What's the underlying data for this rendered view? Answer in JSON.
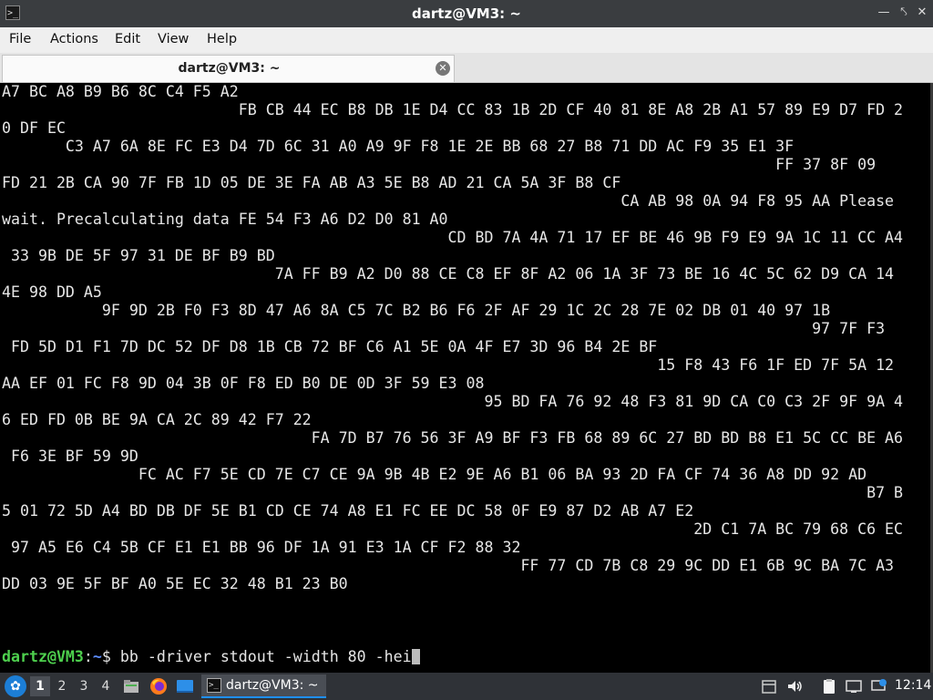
{
  "window": {
    "title": "dartz@VM3: ~"
  },
  "menu": [
    "File",
    "Actions",
    "Edit",
    "View",
    "Help"
  ],
  "tab": {
    "label": "dartz@VM3: ~"
  },
  "terminal": {
    "lines": [
      "A7 BC A8 B9 B6 8C C4 F5 A2",
      "                          FB CB 44 EC B8 DB 1E D4 CC 83 1B 2D CF 40 81 8E A8 2B A1 57 89 E9 D7 FD 2",
      "0 DF EC",
      "       C3 A7 6A 8E FC E3 D4 7D 6C 31 A0 A9 9F F8 1E 2E BB 68 27 B8 71 DD AC F9 35 E1 3F",
      "                                                                                     FF 37 8F 09",
      "FD 21 2B CA 90 7F FB 1D 05 DE 3E FA AB A3 5E B8 AD 21 CA 5A 3F B8 CF",
      "                                                                    CA AB 98 0A 94 F8 95 AA Please",
      "wait. Precalculating data FE 54 F3 A6 D2 D0 81 A0",
      "                                                 CD BD 7A 4A 71 17 EF BE 46 9B F9 E9 9A 1C 11 CC A4",
      " 33 9B DE 5F 97 31 DE BF B9 BD",
      "                              7A FF B9 A2 D0 88 CE C8 EF 8F A2 06 1A 3F 73 BE 16 4C 5C 62 D9 CA 14",
      "4E 98 DD A5",
      "           9F 9D 2B F0 F3 8D 47 A6 8A C5 7C B2 B6 F6 2F AF 29 1C 2C 28 7E 02 DB 01 40 97 1B",
      "                                                                                         97 7F F3",
      " FD 5D D1 F1 7D DC 52 DF D8 1B CB 72 BF C6 A1 5E 0A 4F E7 3D 96 B4 2E BF",
      "                                                                        15 F8 43 F6 1F ED 7F 5A 12",
      "AA EF 01 FC F8 9D 04 3B 0F F8 ED B0 DE 0D 3F 59 E3 08",
      "                                                     95 BD FA 76 92 48 F3 81 9D CA C0 C3 2F 9F 9A 4",
      "6 ED FD 0B BE 9A CA 2C 89 42 F7 22",
      "                                  FA 7D B7 76 56 3F A9 BF F3 FB 68 89 6C 27 BD BD B8 E1 5C CC BE A6",
      " F6 3E BF 59 9D",
      "               FC AC F7 5E CD 7E C7 CE 9A 9B 4B E2 9E A6 B1 06 BA 93 2D FA CF 74 36 A8 DD 92 AD",
      "                                                                                               B7 B",
      "5 01 72 5D A4 BD DB DF 5E B1 CD CE 74 A8 E1 FC EE DC 58 0F E9 87 D2 AB A7 E2",
      "                                                                            2D C1 7A BC 79 68 C6 EC",
      " 97 A5 E6 C4 5B CF E1 E1 BB 96 DF 1A 91 E3 1A CF F2 88 32",
      "                                                         FF 77 CD 7B C8 29 9C DD E1 6B 9C BA 7C A3",
      "DD 03 9E 5F BF A0 5E EC 32 48 B1 23 B0"
    ],
    "prompt": {
      "user_host": "dartz@VM3",
      "separator": ":",
      "path": "~",
      "symbol": "$",
      "command": "bb -driver stdout -width 80 -hei"
    }
  },
  "taskbar": {
    "workspaces": [
      "1",
      "2",
      "3",
      "4"
    ],
    "active_workspace": "1",
    "task_label": "dartz@VM3: ~",
    "clock": "12:14"
  },
  "icons": {
    "start": "lxqt-start-icon",
    "file_manager": "file-manager-icon",
    "browser": "firefox-icon",
    "desktop": "show-desktop-icon",
    "terminal": "terminal-icon"
  },
  "colors": {
    "prompt_user": "#4ed04e",
    "prompt_path": "#5c8cff",
    "terminal_bg": "#000000",
    "terminal_fg": "#e6e6e6"
  }
}
